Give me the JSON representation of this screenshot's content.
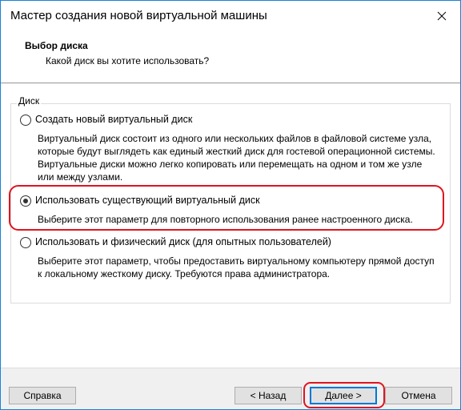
{
  "window": {
    "title": "Мастер создания новой виртуальной машины"
  },
  "header": {
    "title": "Выбор диска",
    "subtitle": "Какой диск вы хотите использовать?"
  },
  "group": {
    "label": "Диск"
  },
  "options": [
    {
      "label": "Создать новый виртуальный диск",
      "description": "Виртуальный диск состоит из одного или нескольких файлов в файловой системе узла, которые будут выглядеть как единый жесткий диск для гостевой операционной системы. Виртуальные диски можно легко копировать или перемещать на одном и том же узле или между узлами.",
      "selected": false
    },
    {
      "label": "Использовать существующий виртуальный диск",
      "description": "Выберите этот параметр для повторного использования ранее настроенного диска.",
      "selected": true
    },
    {
      "label": "Использовать и физический диск (для опытных пользователей)",
      "description": "Выберите этот параметр, чтобы предоставить виртуальному компьютеру прямой доступ к локальному жесткому диску. Требуются права администратора.",
      "selected": false
    }
  ],
  "buttons": {
    "help": "Справка",
    "back": "< Назад",
    "next": "Далее >",
    "cancel": "Отмена"
  },
  "colors": {
    "highlight": "#e0141f",
    "accent": "#0078d7"
  },
  "icons": {
    "close": "close-icon"
  }
}
